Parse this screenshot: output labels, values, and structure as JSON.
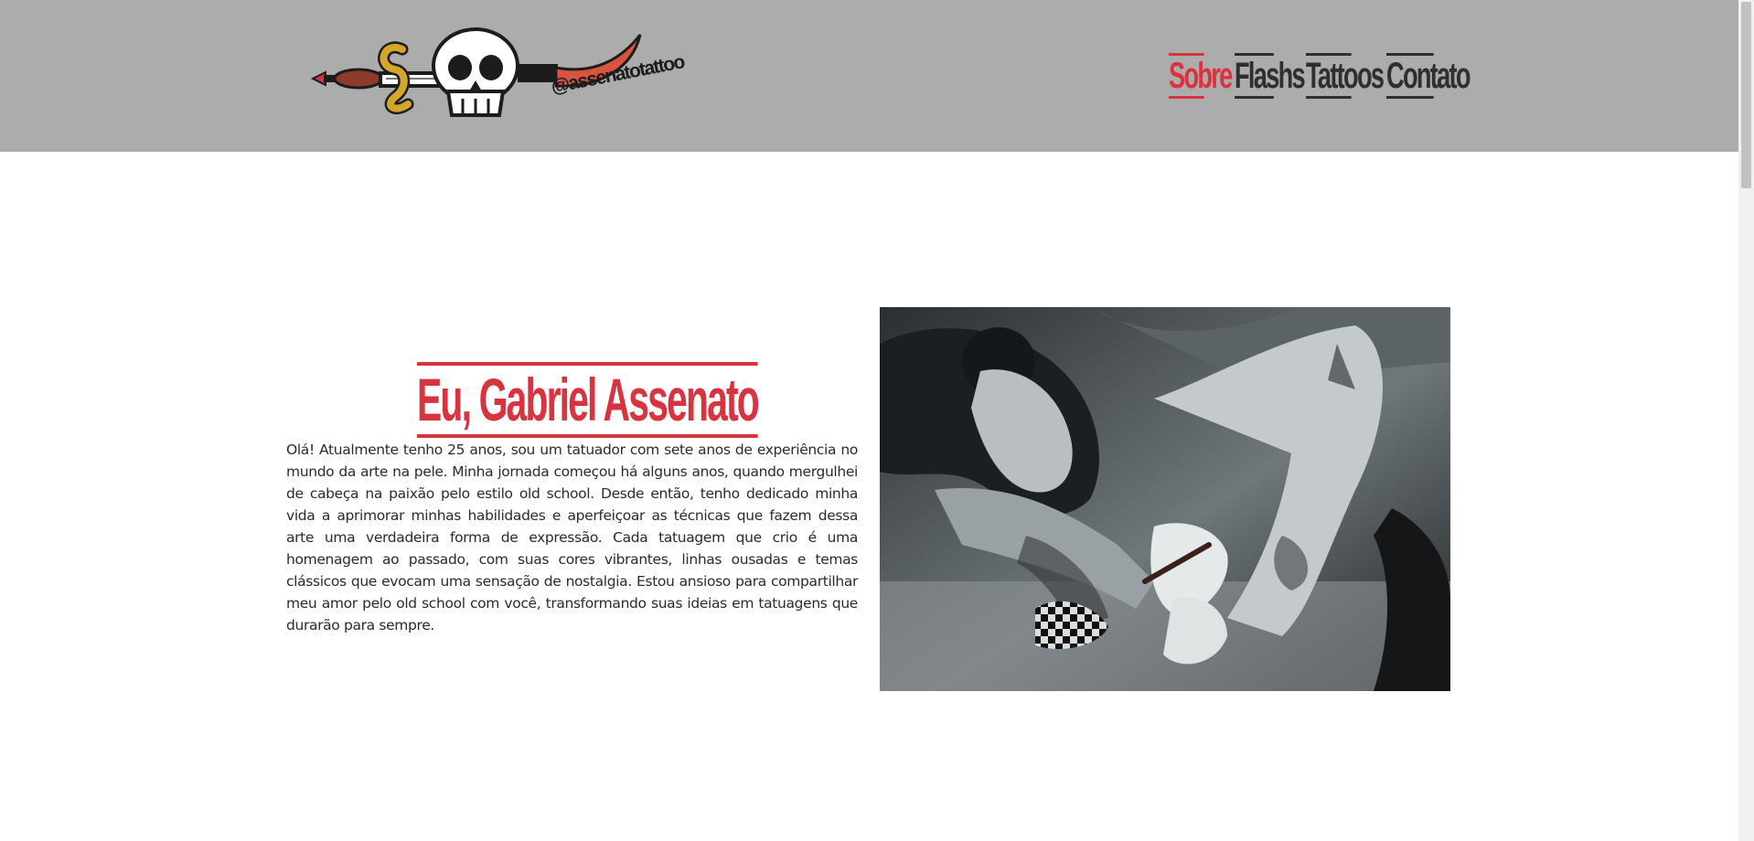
{
  "header": {
    "logo": {
      "handle": "@assenatotattoo"
    },
    "nav": [
      {
        "label": "Sobre",
        "active": true
      },
      {
        "label": "Flashs",
        "active": false
      },
      {
        "label": "Tattoos",
        "active": false
      },
      {
        "label": "Contato",
        "active": false
      }
    ]
  },
  "about": {
    "title": "Eu, Gabriel Assenato",
    "bio": "Olá! Atualmente tenho 25 anos, sou um tatuador com sete anos de experiência no mundo da arte na pele. Minha jornada começou há alguns anos, quando mergulhei de cabeça na paixão pelo estilo old school. Desde então, tenho dedicado minha vida a aprimorar minhas habilidades e aperfeiçoar as técnicas que fazem dessa arte uma verdadeira forma de expressão. Cada tatuagem que crio é uma homenagem ao passado, com suas cores vibrantes, linhas ousadas e temas clássicos que evocam uma sensação de nostalgia. Estou ansioso para compartilhar meu amor pelo old school com você, transformando suas ideias em tatuagens que durarão para sempre."
  },
  "colors": {
    "header_bg": "#acacac",
    "accent": "#d8343f",
    "nav_text": "#2f2f2f",
    "body_text": "#2b2b2b"
  },
  "icons": [
    "skull-dagger-logo-icon"
  ]
}
